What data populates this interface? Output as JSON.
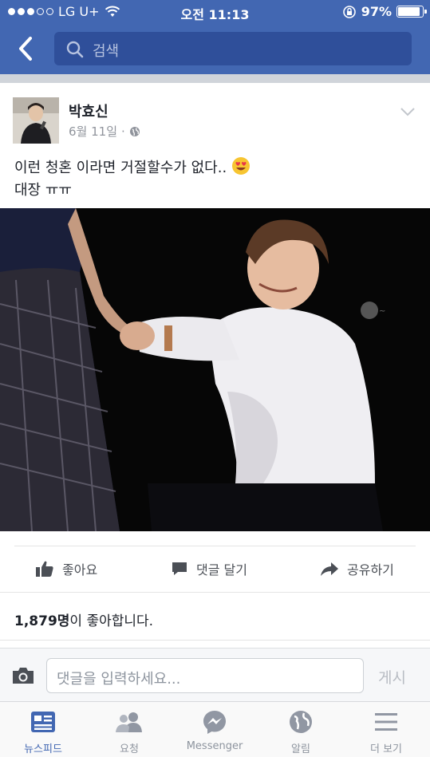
{
  "status_bar": {
    "carrier": "LG U+",
    "time": "오전 11:13",
    "battery": "97%",
    "battery_level": 0.97
  },
  "header": {
    "search_placeholder": "검색"
  },
  "post": {
    "author": "박효신",
    "date": "6월 11일",
    "separator": "·",
    "text_line1": "이런 청혼 이라면 거절할수가 없다..",
    "text_line2": "대장 ㅠㅠ",
    "emoji": "smiling-face-with-heart-eyes"
  },
  "actions": {
    "like": "좋아요",
    "comment": "댓글 달기",
    "share": "공유하기"
  },
  "likes": {
    "count": "1,879명",
    "suffix": "이 좋아합니다."
  },
  "comment_bar": {
    "placeholder": "댓글을 입력하세요...",
    "post_label": "게시"
  },
  "tabs": [
    {
      "label": "뉴스피드",
      "icon": "newsfeed-icon",
      "active": true
    },
    {
      "label": "요청",
      "icon": "friend-requests-icon",
      "active": false
    },
    {
      "label": "Messenger",
      "icon": "messenger-icon",
      "active": false
    },
    {
      "label": "알림",
      "icon": "globe-icon",
      "active": false
    },
    {
      "label": "더 보기",
      "icon": "menu-icon",
      "active": false
    }
  ],
  "colors": {
    "brand": "#4267b2",
    "search_bg": "#2f4f9a",
    "text": "#1d2129",
    "muted": "#90949c"
  }
}
